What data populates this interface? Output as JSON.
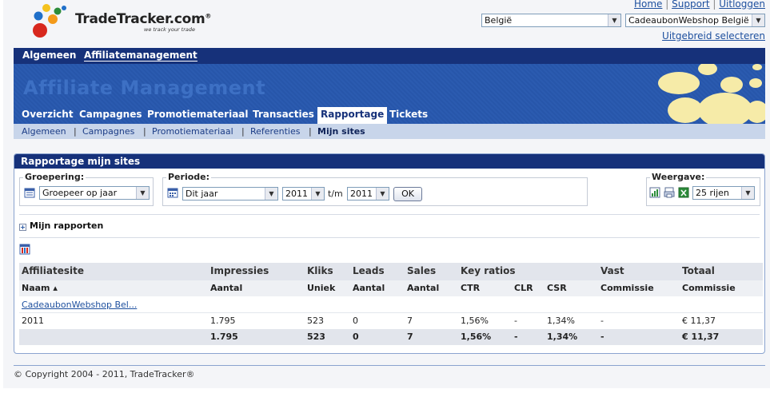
{
  "brand": {
    "name": "TradeTracker.com",
    "trademark": "®",
    "tagline": "we track your trade"
  },
  "toplinks": {
    "home": "Home",
    "support": "Support",
    "logout": "Uitloggen",
    "sep": "|"
  },
  "selectors": {
    "country": "België",
    "site": "CadeaubonWebshop België",
    "advanced": "Uitgebreid selecteren"
  },
  "topnav": {
    "general": "Algemeen",
    "affiliate": "Affiliatemanagement"
  },
  "banner": {
    "title": "Affiliate Management"
  },
  "tabs": [
    "Overzicht",
    "Campagnes",
    "Promotiemateriaal",
    "Transacties",
    "Rapportage",
    "Tickets"
  ],
  "active_tab": "Rapportage",
  "subnav": {
    "items": [
      "Algemeen",
      "Campagnes",
      "Promotiemateriaal",
      "Referenties",
      "Mijn sites"
    ],
    "sep": "|",
    "active": "Mijn sites"
  },
  "panel": {
    "title": "Rapportage mijn sites"
  },
  "filters": {
    "grouping_label": "Groepering:",
    "grouping_value": "Groepeer op jaar",
    "period_label": "Periode:",
    "period_value": "Dit jaar",
    "year_from": "2011",
    "range_sep": "t/m",
    "year_to": "2011",
    "ok": "OK",
    "view_label": "Weergave:",
    "rows_value": "25 rijen"
  },
  "my_reports": "Mijn rapporten",
  "table": {
    "headers1": {
      "site": "Affiliatesite",
      "impressions": "Impressies",
      "clicks": "Kliks",
      "leads": "Leads",
      "sales": "Sales",
      "ratios": "Key ratios",
      "fixed": "Vast",
      "total": "Totaal"
    },
    "headers2": {
      "name": "Naam ▴",
      "impr": "Aantal",
      "clicks": "Uniek",
      "leads": "Aantal",
      "sales": "Aantal",
      "ctr": "CTR",
      "clr": "CLR",
      "csr": "CSR",
      "fixed": "Commissie",
      "total": "Commissie"
    },
    "group_link": "CadeaubonWebshop Bel...",
    "row": {
      "label": "2011",
      "impr": "1.795",
      "clicks": "523",
      "leads": "0",
      "sales": "7",
      "ctr": "1,56%",
      "clr": "-",
      "csr": "1,34%",
      "fixed": "-",
      "total": "€ 11,37"
    },
    "totals": {
      "impr": "1.795",
      "clicks": "523",
      "leads": "0",
      "sales": "7",
      "ctr": "1,56%",
      "clr": "-",
      "csr": "1,34%",
      "fixed": "-",
      "total": "€ 11,37"
    }
  },
  "footer": "© Copyright 2004 - 2011, TradeTracker®",
  "colors": {
    "navy": "#16317a",
    "banner": "#2b5bb0",
    "link": "#1d4f9e",
    "circles": "#f6eba8"
  }
}
